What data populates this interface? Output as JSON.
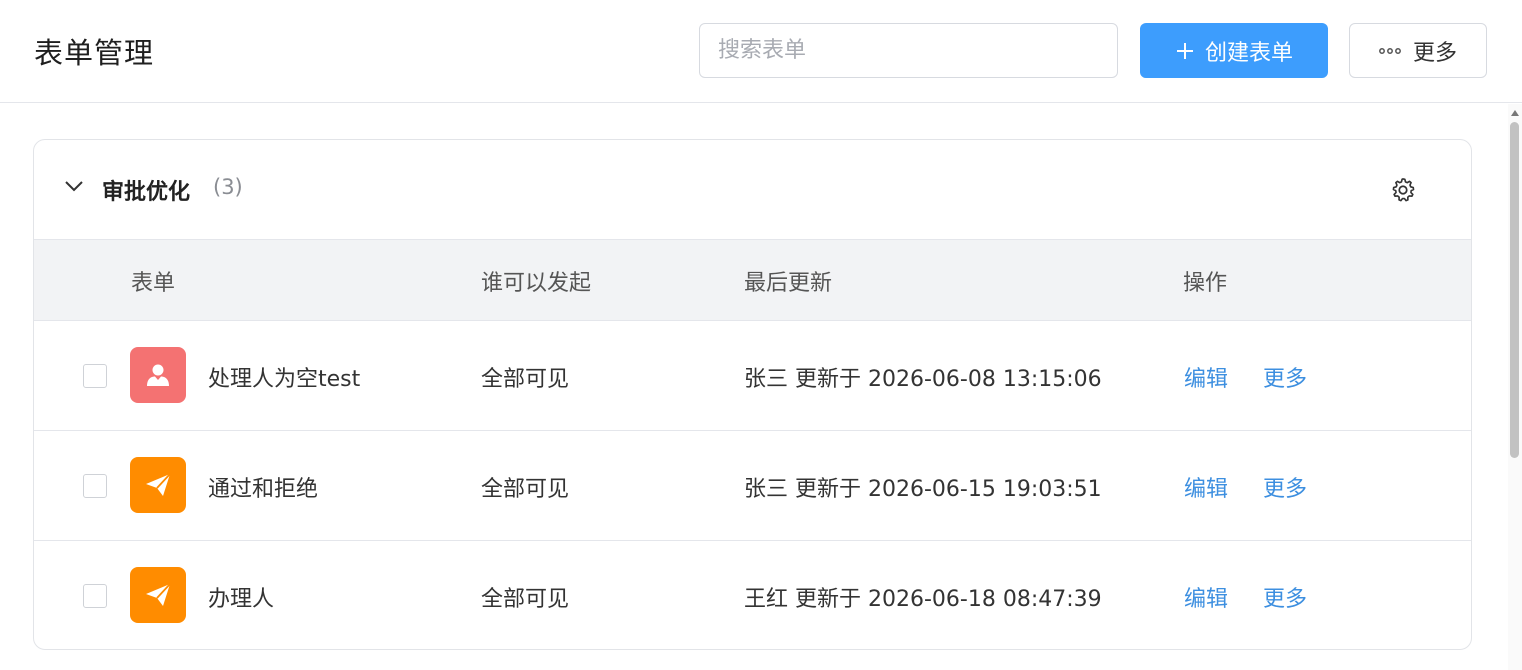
{
  "header": {
    "title": "表单管理",
    "search_placeholder": "搜索表单",
    "create_label": "创建表单",
    "more_label": "更多"
  },
  "colors": {
    "primary": "#3d9dfd",
    "link": "#3d8fe0",
    "icon_red": "#f47272",
    "icon_orange": "#ff8c00"
  },
  "group": {
    "name": "审批优化",
    "count": "(3)"
  },
  "table": {
    "columns": [
      "表单",
      "谁可以发起",
      "最后更新",
      "操作"
    ],
    "rows": [
      {
        "icon": "person-icon",
        "icon_color": "#f47272",
        "name": "处理人为空test",
        "visibility": "全部可见",
        "updated": "张三 更新于 2026-06-08 13:15:06",
        "edit": "编辑",
        "more": "更多"
      },
      {
        "icon": "paper-plane-icon",
        "icon_color": "#ff8c00",
        "name": "通过和拒绝",
        "visibility": "全部可见",
        "updated": "张三 更新于 2026-06-15 19:03:51",
        "edit": "编辑",
        "more": "更多"
      },
      {
        "icon": "paper-plane-icon",
        "icon_color": "#ff8c00",
        "name": "办理人",
        "visibility": "全部可见",
        "updated": "王红 更新于 2026-06-18 08:47:39",
        "edit": "编辑",
        "more": "更多"
      }
    ]
  }
}
